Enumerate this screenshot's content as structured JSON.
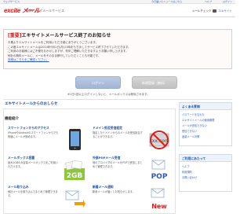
{
  "topbar": {
    "left_link": "ウェブサービス",
    "right_links": [
      "今日届いたニュースはこちら",
      "ヘルプ",
      "ログイン"
    ]
  },
  "header": {
    "logo": "excite",
    "logo_suffix": "メール",
    "subtitle": "無料ウェブメールサービス",
    "user_label": "メールチェック",
    "user_name": "エキサイト"
  },
  "notice": {
    "tag": "[重要]",
    "title": "エキサイトメールサービス終了のお知らせ",
    "lines": [
      "平素よりエキサイトメールをご利用いただき誠にありがとうございます。",
      "この度エキサイトメールは2014年9月1日(月)11時をもちましてサービス終了させていただきます。",
      "ご利用のお客様にはご不便をおかけしますが、何卒ご理解いただきますようお願い申し上げます。",
      "他社の無料メールに、メールをそのまま移行していただくことも可能です。",
      "詳細はこちらをご確認ください。"
    ]
  },
  "buttons": {
    "login": "ログイン",
    "signup": "新規登録（無料）",
    "note": "※1日1回以上ログインしないと、メールボックスは削除されます。"
  },
  "section": {
    "title": "エキサイトメールからのおしらせ",
    "features_heading": "機能紹介"
  },
  "features": [
    {
      "title": "スマートフォンからのアクセス",
      "desc": "iPhoneやAndroidのスマートフォンからでも快適にメールが読めます。",
      "icon": "smartphone-icon"
    },
    {
      "title": "ドメイン拒否受信設定",
      "desc": "指定したドメインからのメールを受信拒否することができます。",
      "icon": "block-icon"
    },
    {
      "title": "メールボックス容量",
      "desc": "最大2GBの大容量メールボックスをご利用いただけます。",
      "icon": "storage-2gb-icon",
      "badge": "2GB"
    },
    {
      "title": "外部POPメール受信",
      "desc": "他のプロバイダのメールをPOPで受信しまとめて管理できます。",
      "icon": "pop-icon",
      "badge": "POP"
    },
    {
      "title": "メール取り込み",
      "desc": "他社メールを取り込んでまとめて管理できます。",
      "icon": "import-icon"
    },
    {
      "title": "新着メール通知",
      "desc": "新着メールが届くとお知らせします。",
      "icon": "new-mail-icon",
      "badge": "New"
    }
  ],
  "sidebar": {
    "help_title": "よくある質問",
    "help_items": [
      "パスワードを忘れた",
      "エキサイトメールの使用期限",
      "メールが送信できない",
      "受信できない",
      "迷惑メール対策"
    ],
    "links_title": "ご利用にあたって",
    "links_items": [
      "ヘルプ",
      "利用規約",
      "お問い合わせ"
    ]
  }
}
